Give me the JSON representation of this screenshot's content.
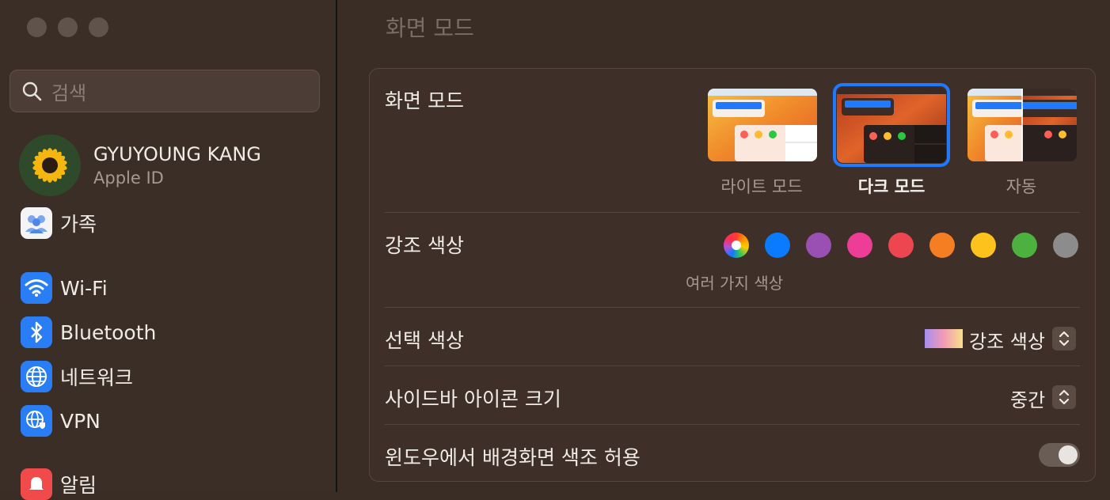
{
  "search": {
    "placeholder": "검색"
  },
  "profile": {
    "name": "GYUYOUNG KANG",
    "subtitle": "Apple ID"
  },
  "sidebar": {
    "items": [
      {
        "label": "가족"
      },
      {
        "label": "Wi-Fi"
      },
      {
        "label": "Bluetooth"
      },
      {
        "label": "네트워크"
      },
      {
        "label": "VPN"
      },
      {
        "label": "알림"
      }
    ]
  },
  "main": {
    "title": "화면 모드",
    "appearance": {
      "label": "화면 모드",
      "options": [
        "라이트 모드",
        "다크 모드",
        "자동"
      ],
      "selected": "다크 모드"
    },
    "accent": {
      "label": "강조 색상",
      "caption": "여러 가지 색상",
      "colors": [
        "#9b5cf6",
        "#0a7aff",
        "#9a4fb2",
        "#ee3d96",
        "#ee4650",
        "#f67e22",
        "#fdc21b",
        "#4db13f",
        "#8c8c8c"
      ]
    },
    "highlight": {
      "label": "선택 색상",
      "value": "강조 색상"
    },
    "sidebar_icon_size": {
      "label": "사이드바 아이콘 크기",
      "value": "중간"
    },
    "wallpaper_tint": {
      "label": "윈도우에서 배경화면 색조 허용",
      "on": true
    }
  },
  "colors": {
    "accent": "#1f7aff",
    "background": "#3a2d26"
  }
}
